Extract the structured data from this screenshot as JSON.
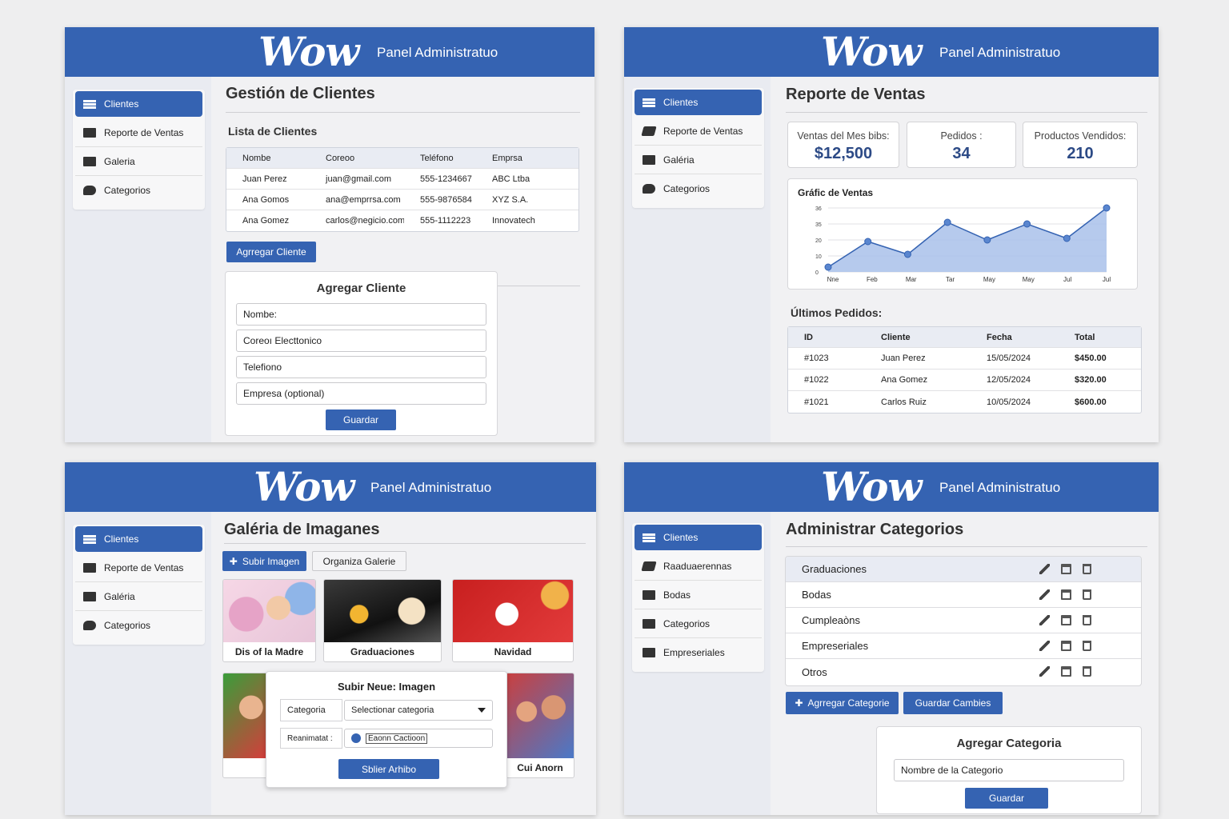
{
  "brand": {
    "logo": "Wow",
    "panel_title": "Panel Administratuo",
    "accent": "#3563b2"
  },
  "sidebar": {
    "clientes": "Clientes",
    "reporte": "Reporte de Ventas",
    "galeria": "Galeria",
    "galeria_accent": "Galéria",
    "categorias": "Categorios",
    "raduaciones": "Raaduaerennas",
    "bodas": "Bodas",
    "empreseriales": "Empreseriales"
  },
  "clients": {
    "title": "Gestión de Clientes",
    "subtitle": "Lista de Clientes",
    "columns": [
      "Nombe",
      "Coreoo",
      "Teléfono",
      "Emprsa"
    ],
    "rows": [
      [
        "Juan Perez",
        "juan@gmail.com",
        "555-1234667",
        "ABC Ltba"
      ],
      [
        "Ana Gomos",
        "ana@emprrsa.com",
        "555-9876584",
        "XYZ S.A."
      ],
      [
        "Ana Gomez",
        "carlos@negicio.com",
        "555-1112223",
        "Innovatech"
      ]
    ],
    "add_button": "Agrregar Cliente",
    "form": {
      "title": "Agregar Cliente",
      "nombre": "Nombe:",
      "correo": "Coreoı Electtonico",
      "telefono": "Telefiono",
      "empresa": "Empresa (optional)",
      "save": "Guardar"
    }
  },
  "sales": {
    "title": "Reporte de Ventas",
    "stats": [
      {
        "label": "Ventas del Mes bibs:",
        "value": "$12,500"
      },
      {
        "label": "Pedidos  :",
        "value": "34"
      },
      {
        "label": "Productos Vendidos:",
        "value": "210"
      }
    ],
    "chart_title": "Gráfic de Ventas",
    "orders_title": "Últimos Pedidos:",
    "order_columns": [
      "ID",
      "Cliente",
      "Fecha",
      "Total"
    ],
    "orders": [
      [
        "#1023",
        "Juan Perez",
        "15/05/2024",
        "$450.00"
      ],
      [
        "#1022",
        "Ana Gomez",
        "12/05/2024",
        "$320.00"
      ],
      [
        "#1021",
        "Carlos Ruiz",
        "10/05/2024",
        "$600.00"
      ]
    ]
  },
  "chart_data": {
    "type": "area",
    "title": "Gráfic de Ventas",
    "categories": [
      "Nne",
      "",
      "Feb",
      "Mar",
      "Tar",
      "May",
      "May",
      "Jul",
      "Jul"
    ],
    "x_ticks": [
      "Nne",
      "Feb",
      "Mar",
      "Tar",
      "May",
      "May",
      "Jul",
      "Jul"
    ],
    "y_ticks": [
      "0",
      "10",
      "20",
      "35",
      "36"
    ],
    "values": [
      3,
      19,
      11,
      31,
      20,
      30,
      21,
      40
    ],
    "ylim": [
      0,
      40
    ],
    "color": "#3563b2",
    "fill": "#a9c1ea",
    "grid": true
  },
  "gallery": {
    "title": "Galéria de Imaganes",
    "upload_btn": "Subir Imagen",
    "organize_btn": "Organiza Galerie",
    "thumbs": [
      "Dis of la Madre",
      "Graduaciones",
      "Navidad",
      "",
      "",
      "Cui Anorn"
    ],
    "modal": {
      "title": "Subir Neue: Imagen",
      "cat_label": "Categoria",
      "cat_value": "Selectionar categoria",
      "file_label": "Reanimatat :",
      "file_value": "Eaonn Cactioon",
      "submit": "Sblier Arhibo"
    }
  },
  "categories": {
    "title": "Administrar Categorios",
    "items": [
      "Graduaciones",
      "Bodas",
      "Cumpleaòns",
      "Empreseriales",
      "Otros"
    ],
    "add_btn": "Agrregar Categorie",
    "save_btn": "Guardar Cambies",
    "form": {
      "title": "Agregar Categoria",
      "name": "Nombre de la Categorio",
      "save": "Guardar"
    }
  }
}
